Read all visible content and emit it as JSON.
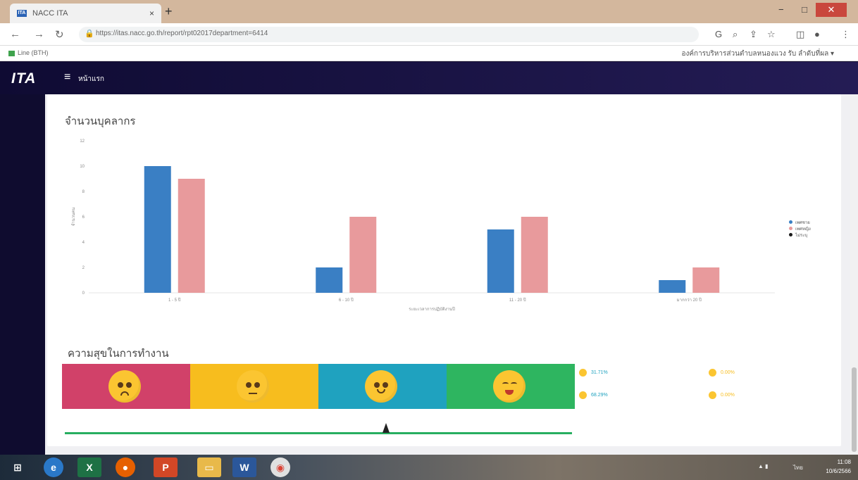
{
  "browser": {
    "tab_title": "NACC ITA",
    "tab_close": "×",
    "new_tab": "+",
    "url": "https://itas.nacc.go.th/report/rpt02017department=6414",
    "minimize": "−",
    "maximize": "□",
    "close": "✕",
    "bookmark_label": "Line (BTH)",
    "profile_text": "องค์การบริหารส่วนตำบลหนองแวง รับ ลำดับที่ผล ▾"
  },
  "app": {
    "logo": "ITA",
    "breadcrumb": "หน้าแรก"
  },
  "personnel_section": {
    "title": "จำนวนบุคลากร"
  },
  "chart_data": {
    "type": "bar",
    "categories": [
      "1 - 5 ปี",
      "6 - 10 ปี",
      "11 - 20 ปี",
      "มากกว่า 20 ปี"
    ],
    "series": [
      {
        "name": "เพศชาย",
        "color": "#3a7fc4",
        "values": [
          10,
          2,
          5,
          1
        ]
      },
      {
        "name": "เพศหญิง",
        "color": "#e89a9c",
        "values": [
          9,
          6,
          6,
          2
        ]
      },
      {
        "name": "ไม่ระบุ",
        "color": "#1a1a1a",
        "values": [
          0,
          0,
          0,
          0
        ]
      }
    ],
    "ylim": [
      0,
      12
    ],
    "yticks": [
      0,
      2,
      4,
      6,
      8,
      10,
      12
    ],
    "ylabel": "จำนวนคน",
    "xlabel": "ระยะเวลาการปฏิบัติงานปี",
    "legend_position": "right",
    "grid": false
  },
  "happiness_section": {
    "title": "ความสุขในการทำงาน",
    "segments": [
      {
        "color": "#d14169",
        "mood": "sad"
      },
      {
        "color": "#f7bd1e",
        "mood": "neutral"
      },
      {
        "color": "#1fa2bf",
        "mood": "happy"
      },
      {
        "color": "#2eb560",
        "mood": "very-happy"
      }
    ],
    "stats": [
      {
        "value": "31.71%",
        "color": "#1fa2bf"
      },
      {
        "value": "0.00%",
        "color": "#f7bd1e"
      },
      {
        "value": "68.29%",
        "color": "#1fa2bf"
      },
      {
        "value": "0.00%",
        "color": "#f7bd1e"
      }
    ],
    "meter_color": "#27ae60"
  },
  "taskbar": {
    "time": "11:08",
    "date": "10/6/2566",
    "lang": "ไทย",
    "apps": [
      "start-icon",
      "ie-icon",
      "excel-icon",
      "firefox-icon",
      "powerpoint-icon",
      "explorer-icon",
      "word-icon",
      "chrome-icon"
    ]
  }
}
